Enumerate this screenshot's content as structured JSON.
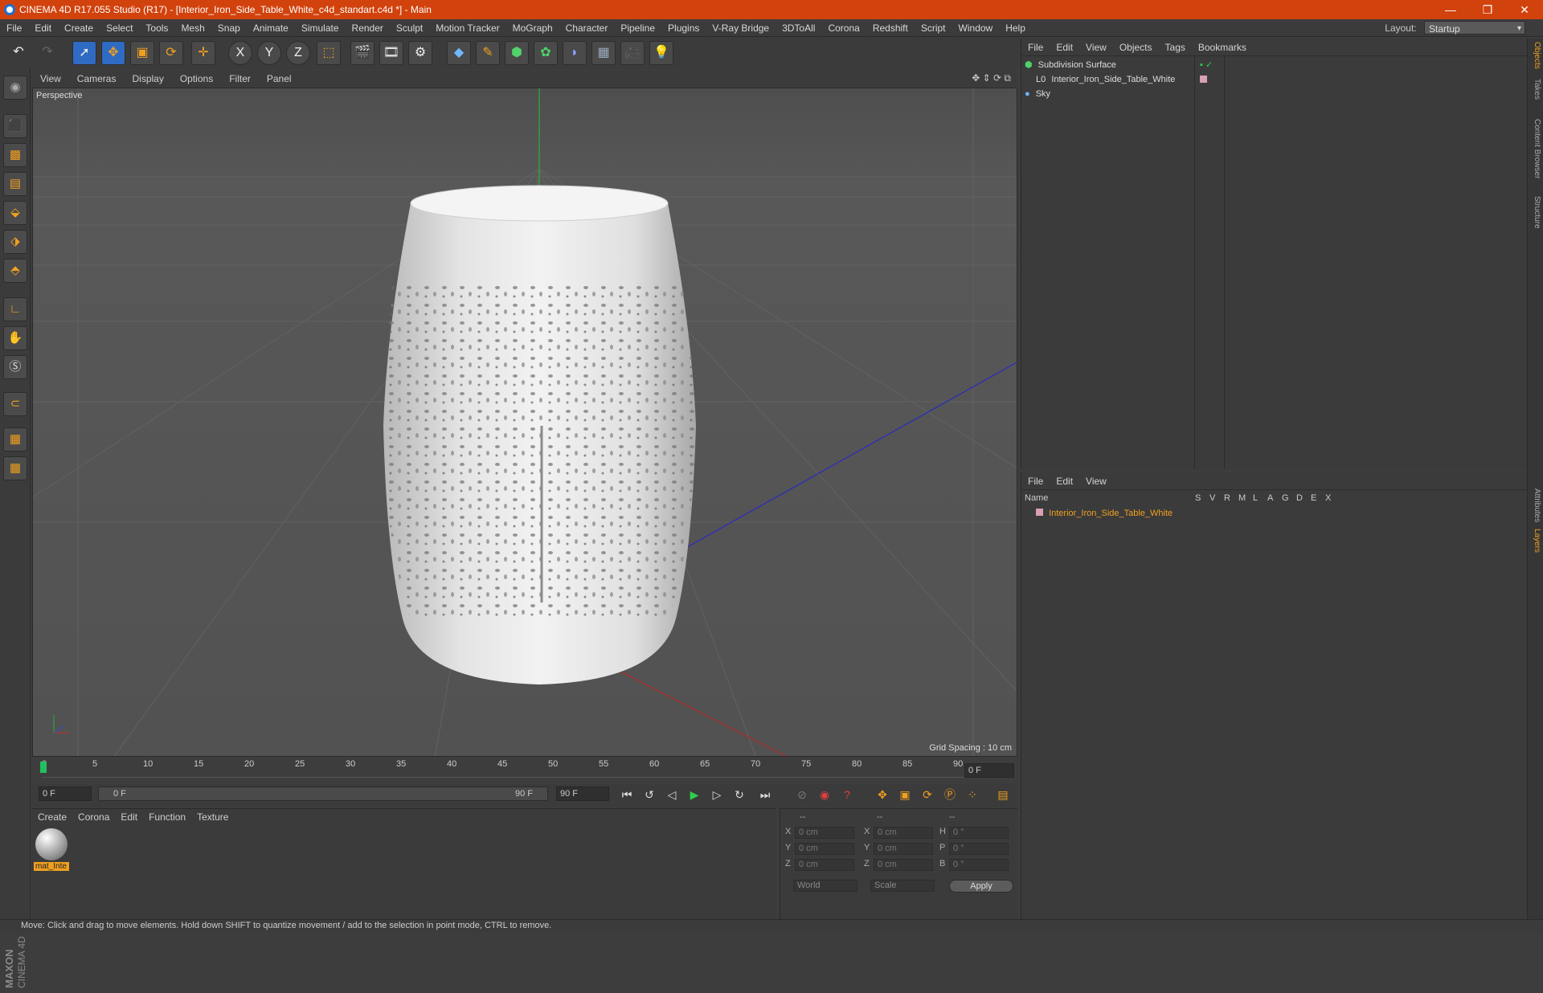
{
  "window": {
    "title": "CINEMA 4D R17.055 Studio (R17) - [Interior_Iron_Side_Table_White_c4d_standart.c4d *] - Main",
    "minimize": "—",
    "restore": "❐",
    "close": "✕"
  },
  "menubar": [
    "File",
    "Edit",
    "Create",
    "Select",
    "Tools",
    "Mesh",
    "Snap",
    "Animate",
    "Simulate",
    "Render",
    "Sculpt",
    "Motion Tracker",
    "MoGraph",
    "Character",
    "Pipeline",
    "Plugins",
    "V-Ray Bridge",
    "3DToAll",
    "Corona",
    "Redshift",
    "Script",
    "Window",
    "Help"
  ],
  "layout": {
    "label": "Layout:",
    "value": "Startup"
  },
  "toolbar_icons": [
    "undo-icon",
    "redo-icon",
    "select-icon",
    "move-icon",
    "scale-icon",
    "rotate-icon",
    "move-plus-icon",
    "x-axis-icon",
    "y-axis-icon",
    "z-axis-icon",
    "coord-system-icon",
    "render-view-icon",
    "render-icon",
    "render-settings-icon",
    "cube-icon",
    "pen-icon",
    "subdivision-icon",
    "cloner-icon",
    "deformer-icon",
    "floor-icon",
    "camera-icon",
    "light-icon"
  ],
  "toolbar_glyphs": {
    "x": "X",
    "y": "Y",
    "z": "Z"
  },
  "viewport": {
    "menu": [
      "View",
      "Cameras",
      "Display",
      "Options",
      "Filter",
      "Panel"
    ],
    "label": "Perspective",
    "grid_spacing": "Grid Spacing : 10 cm"
  },
  "timeline": {
    "ticks": [
      "0",
      "5",
      "10",
      "15",
      "20",
      "25",
      "30",
      "35",
      "40",
      "45",
      "50",
      "55",
      "60",
      "65",
      "70",
      "75",
      "80",
      "85",
      "90"
    ],
    "current_frame": "0 F",
    "start": "0 F",
    "range_start": "0 F",
    "range_end": "90 F",
    "end": "90 F"
  },
  "materials": {
    "menu": [
      "Create",
      "Corona",
      "Edit",
      "Function",
      "Texture"
    ],
    "items": [
      {
        "name": "mat_Inte"
      }
    ]
  },
  "coords": {
    "headers": [
      "--",
      "--",
      "--"
    ],
    "rows": [
      {
        "a": "X",
        "av": "0 cm",
        "b": "X",
        "bv": "0 cm",
        "c": "H",
        "cv": "0 °"
      },
      {
        "a": "Y",
        "av": "0 cm",
        "b": "Y",
        "bv": "0 cm",
        "c": "P",
        "cv": "0 °"
      },
      {
        "a": "Z",
        "av": "0 cm",
        "b": "Z",
        "bv": "0 cm",
        "c": "B",
        "cv": "0 °"
      }
    ],
    "world": "World",
    "scale": "Scale",
    "apply": "Apply"
  },
  "objects": {
    "menu": [
      "File",
      "Edit",
      "View",
      "Objects",
      "Tags",
      "Bookmarks"
    ],
    "items": [
      {
        "name": "Subdivision Surface"
      },
      {
        "name": "Interior_Iron_Side_Table_White"
      },
      {
        "name": "Sky"
      }
    ]
  },
  "layers": {
    "menu": [
      "File",
      "Edit",
      "View"
    ],
    "header": {
      "name": "Name",
      "cols": [
        "S",
        "V",
        "R",
        "M",
        "L",
        "A",
        "G",
        "D",
        "E",
        "X"
      ]
    },
    "items": [
      {
        "name": "Interior_Iron_Side_Table_White"
      }
    ]
  },
  "right_tabs": [
    "Objects",
    "Takes",
    "Content Browser",
    "Structure",
    "Attributes",
    "Layers"
  ],
  "status": "Move: Click and drag to move elements. Hold down SHIFT to quantize movement / add to the selection in point mode, CTRL to remove.",
  "brand": {
    "line1": "MAXON",
    "line2": "CINEMA 4D"
  },
  "colors": {
    "title_bar": "#d2420c",
    "accent_orange": "#f0a020",
    "selection_blue": "#2f6bc2"
  }
}
